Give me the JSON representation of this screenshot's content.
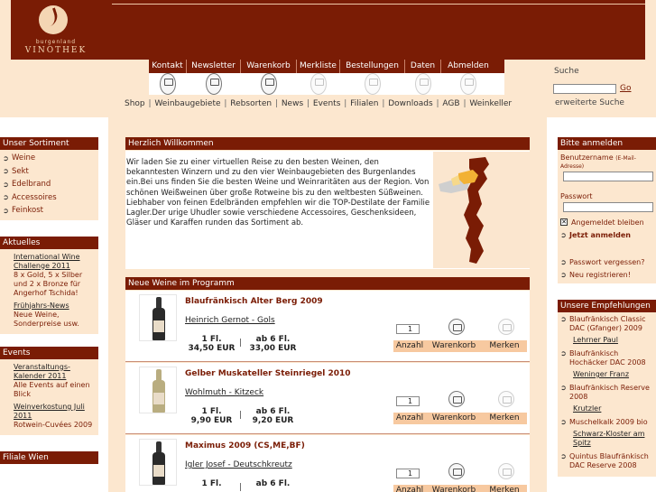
{
  "brand": {
    "subtitle": "burgenland",
    "name": "VINOTHEK"
  },
  "topnav": [
    {
      "label": "Kontakt",
      "w": 42
    },
    {
      "label": "Newsletter",
      "w": 60
    },
    {
      "label": "Warenkorb",
      "w": 62
    },
    {
      "label": "Merkliste",
      "w": 48
    },
    {
      "label": "Bestellungen",
      "w": 72
    },
    {
      "label": "Daten",
      "w": 40
    },
    {
      "label": "Abmelden",
      "w": 60
    }
  ],
  "search": {
    "label": "Suche",
    "go": "Go",
    "advanced": "erweiterte Suche"
  },
  "secnav": [
    "Shop",
    "Weinbaugebiete",
    "Rebsorten",
    "News",
    "Events",
    "Filialen",
    "Downloads",
    "AGB",
    "Weinkeller"
  ],
  "sidebar": {
    "sortiment_title": "Unser Sortiment",
    "sortiment": [
      "Weine",
      "Sekt",
      "Edelbrand",
      "Accessoires",
      "Feinkost"
    ],
    "aktuelles_title": "Aktuelles",
    "aktuelles": [
      {
        "title": "International Wine Challenge 2011",
        "desc": "8 x Gold, 5 x Silber und 2 x Bronze für Angerhof Tschida!"
      },
      {
        "title": "Frühjahrs-News",
        "desc": "Neue Weine, Sonderpreise usw."
      }
    ],
    "events_title": "Events",
    "events": [
      {
        "title": "Veranstaltungs- Kalender 2011",
        "desc": "Alle Events auf einen Blick"
      },
      {
        "title": "Weinverkostung Juli 2011",
        "desc": "Rotwein-Cuvées 2009"
      }
    ],
    "filiale_title": "Filiale Wien"
  },
  "login": {
    "title": "Bitte anmelden",
    "user_label": "Benutzername",
    "user_hint": "(E-Mail-Adresse)",
    "pass_label": "Passwort",
    "remember": "Angemeldet bleiben",
    "login_now": "Jetzt anmelden",
    "forgot": "Passwort vergessen?",
    "register": "Neu registrieren!"
  },
  "recommendations": {
    "title": "Unsere Empfehlungen",
    "items": [
      {
        "name": "Blaufränkisch Classic DAC (Gfanger) 2009",
        "producer": "Lehrner Paul"
      },
      {
        "name": "Blaufränkisch Hochäcker DAC 2008",
        "producer": "Weninger Franz"
      },
      {
        "name": "Blaufränkisch Reserve 2008",
        "producer": "Krutzler"
      },
      {
        "name": "Muschelkalk 2009 bio",
        "producer": "Schwarz-Kloster am Spitz"
      },
      {
        "name": "Quintus Blaufränkisch DAC Reserve 2008",
        "producer": ""
      }
    ]
  },
  "welcome": {
    "title": "Herzlich Willkommen",
    "text": "Wir laden Sie zu einer virtuellen Reise zu den besten Weinen, den bekanntesten Winzern und zu den vier Weinbaugebieten des Burgenlandes ein.Bei uns finden Sie die besten Weine und Weinraritäten aus der Region. Von schönen Weißweinen über große Rotweine bis zu den weltbesten Süßweinen. Liebhaber von feinen Edelbränden empfehlen wir die TOP-Destilate der Familie Lagler.Der urige Uhudler sowie verschiedene Accessoires, Geschenksideen, Gläser und Karaffen runden das Sortiment ab."
  },
  "new_wines": {
    "title": "Neue Weine im Programm",
    "qty_label": "Anzahl",
    "cart_label": "Warenkorb",
    "remember_label": "Merken",
    "items": [
      {
        "name": "Blaufränkisch Alter Berg 2009",
        "producer": "Heinrich Gernot - Gols",
        "unit1": "1 Fl.",
        "price1": "34,50 EUR",
        "unit2": "ab 6 Fl.",
        "price2": "33,00 EUR",
        "qty": "1",
        "color": "red"
      },
      {
        "name": "Gelber Muskateller Steinriegel 2010",
        "producer": "Wohlmuth - Kitzeck",
        "unit1": "1 Fl.",
        "price1": "9,90 EUR",
        "unit2": "ab 6 Fl.",
        "price2": "9,20 EUR",
        "qty": "1",
        "color": "white"
      },
      {
        "name": "Maximus 2009 (CS,ME,BF)",
        "producer": "Igler Josef - Deutschkreutz",
        "unit1": "1 Fl.",
        "price1": "",
        "unit2": "ab 6 Fl.",
        "price2": "",
        "qty": "1",
        "color": "red"
      }
    ]
  },
  "colors": {
    "brand": "#7a1c05",
    "cream": "#fce7cf",
    "accent": "#f7c9a0"
  }
}
